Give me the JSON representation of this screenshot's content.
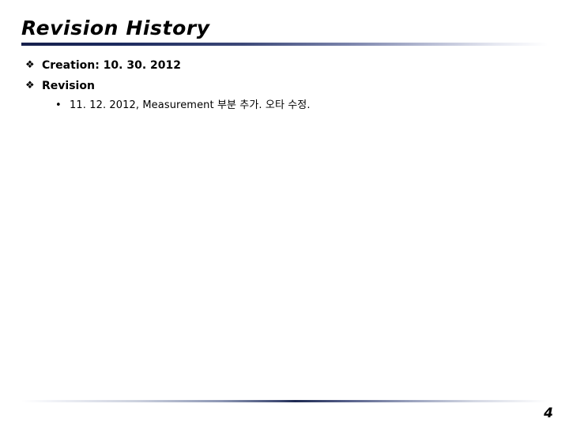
{
  "slide": {
    "title": "Revision History",
    "page_number": "4",
    "accent_color": "#16204c",
    "background_color": "#ffffff",
    "text_color": "#000000"
  },
  "bullets": [
    {
      "level": 1,
      "marker": "❖",
      "marker_name": "diamond-bullet",
      "text": "Creation: 10. 30. 2012"
    },
    {
      "level": 1,
      "marker": "❖",
      "marker_name": "diamond-bullet",
      "text": "Revision"
    },
    {
      "level": 2,
      "marker": "•",
      "marker_name": "dot-bullet",
      "text": "11. 12. 2012, Measurement 부분 추가. 오타 수정."
    }
  ]
}
